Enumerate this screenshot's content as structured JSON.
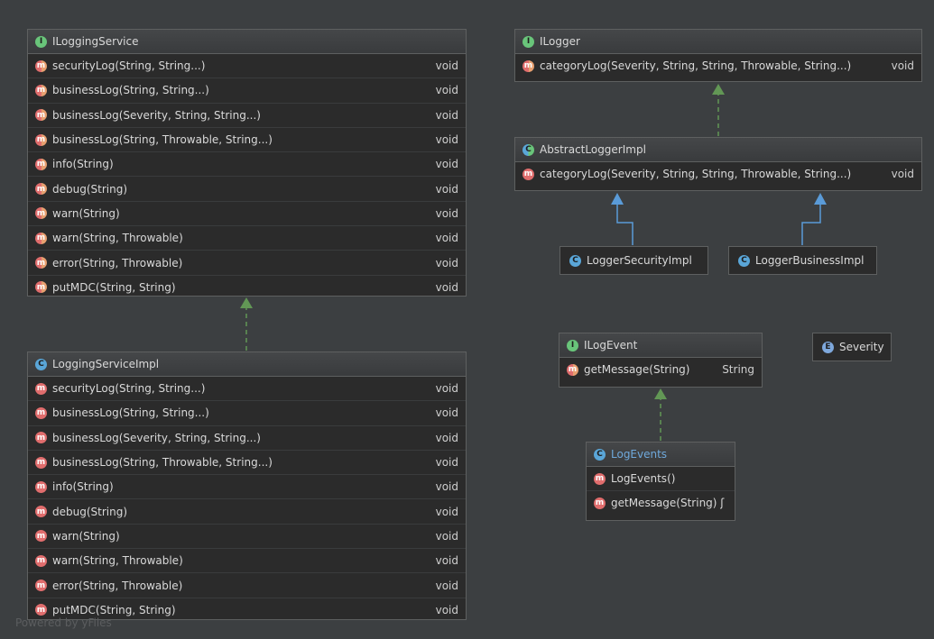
{
  "nodes": {
    "ilogging_service": {
      "title": "ILoggingService",
      "methods": [
        {
          "name": "securityLog(String, String...)",
          "ret": "void"
        },
        {
          "name": "businessLog(String, String...)",
          "ret": "void"
        },
        {
          "name": "businessLog(Severity, String, String...)",
          "ret": "void"
        },
        {
          "name": "businessLog(String, Throwable, String...)",
          "ret": "void"
        },
        {
          "name": "info(String)",
          "ret": "void"
        },
        {
          "name": "debug(String)",
          "ret": "void"
        },
        {
          "name": "warn(String)",
          "ret": "void"
        },
        {
          "name": "warn(String, Throwable)",
          "ret": "void"
        },
        {
          "name": "error(String, Throwable)",
          "ret": "void"
        },
        {
          "name": "putMDC(String, String)",
          "ret": "void"
        }
      ]
    },
    "logging_service_impl": {
      "title": "LoggingServiceImpl",
      "methods": [
        {
          "name": "securityLog(String, String...)",
          "ret": "void"
        },
        {
          "name": "businessLog(String, String...)",
          "ret": "void"
        },
        {
          "name": "businessLog(Severity, String, String...)",
          "ret": "void"
        },
        {
          "name": "businessLog(String, Throwable, String...)",
          "ret": "void"
        },
        {
          "name": "info(String)",
          "ret": "void"
        },
        {
          "name": "debug(String)",
          "ret": "void"
        },
        {
          "name": "warn(String)",
          "ret": "void"
        },
        {
          "name": "warn(String, Throwable)",
          "ret": "void"
        },
        {
          "name": "error(String, Throwable)",
          "ret": "void"
        },
        {
          "name": "putMDC(String, String)",
          "ret": "void"
        }
      ]
    },
    "ilogger": {
      "title": "ILogger",
      "methods": [
        {
          "name": "categoryLog(Severity, String, String, Throwable, String...)",
          "ret": "void"
        }
      ]
    },
    "abstract_logger_impl": {
      "title": "AbstractLoggerImpl",
      "methods": [
        {
          "name": "categoryLog(Severity, String, String, Throwable, String...)",
          "ret": "void"
        }
      ]
    },
    "logger_security_impl": {
      "title": "LoggerSecurityImpl"
    },
    "logger_business_impl": {
      "title": "LoggerBusinessImpl"
    },
    "ilog_event": {
      "title": "ILogEvent",
      "methods": [
        {
          "name": "getMessage(String)",
          "ret": "String"
        }
      ]
    },
    "severity": {
      "title": "Severity"
    },
    "log_events": {
      "title": "LogEvents",
      "methods": [
        {
          "name": "LogEvents()",
          "ret": ""
        },
        {
          "name": "getMessage(String) ʃ",
          "ret": ""
        }
      ]
    }
  },
  "badges": {
    "interface": "I",
    "class": "C",
    "abstract": "C",
    "enum": "E",
    "method": "m"
  },
  "colors": {
    "background": "#3c3f41",
    "node_fill": "#2b2b2b",
    "implements_arrow": "#629755",
    "extends_arrow": "#5a9bd8",
    "interface_badge": "#69c57a",
    "class_badge": "#5aa6d8",
    "method_badge": "#e06d6d"
  },
  "watermark": "Powered by yFiles"
}
